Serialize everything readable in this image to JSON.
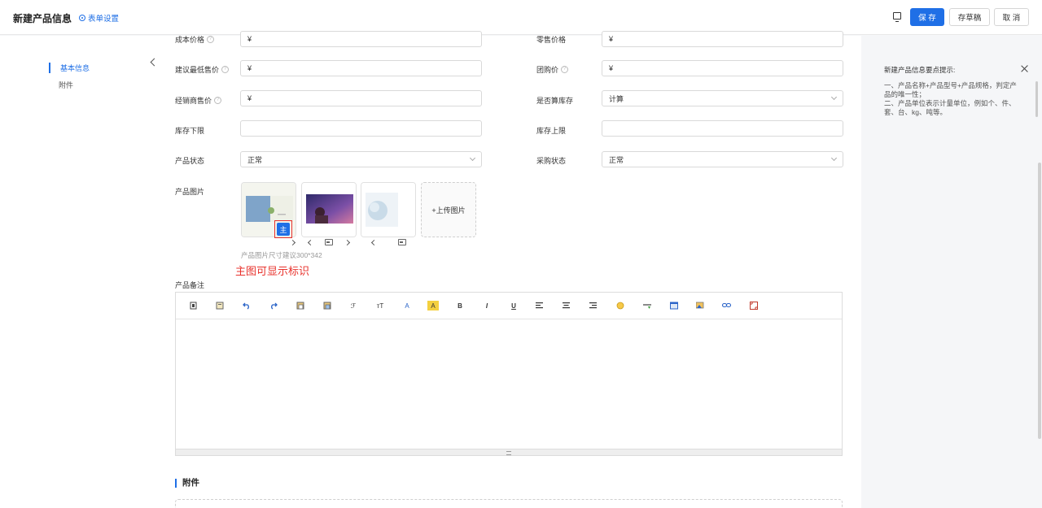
{
  "header": {
    "title": "新建产品信息",
    "form_settings": "表单设置",
    "save": "保 存",
    "draft": "存草稿",
    "cancel": "取 消"
  },
  "sidenav": {
    "items": [
      {
        "label": "基本信息",
        "active": true
      },
      {
        "label": "附件",
        "active": false
      }
    ]
  },
  "form": {
    "cost_price": {
      "label": "成本价格",
      "value": "¥"
    },
    "retail_price": {
      "label": "零售价格",
      "value": "¥"
    },
    "min_price": {
      "label": "建议最低售价",
      "value": "¥"
    },
    "group_price": {
      "label": "团购价",
      "value": "¥"
    },
    "dealer_price": {
      "label": "经销商售价",
      "value": "¥"
    },
    "count_stock": {
      "label": "是否算库存",
      "value": "计算"
    },
    "stock_min": {
      "label": "库存下限",
      "value": ""
    },
    "stock_max": {
      "label": "库存上限",
      "value": ""
    },
    "product_status": {
      "label": "产品状态",
      "value": "正常"
    },
    "purchase_status": {
      "label": "采购状态",
      "value": "正常"
    },
    "product_images": {
      "label": "产品图片",
      "main_badge": "主",
      "upload_label": "+上传图片",
      "size_hint": "产品图片尺寸建议300*342"
    },
    "annotation": "主图可显示标识",
    "product_remark": {
      "label": "产品备注"
    }
  },
  "editor_toolbar": [
    "source-icon",
    "template-icon",
    "undo-icon",
    "redo-icon",
    "paste-icon",
    "paste-text-icon",
    "font-family-icon",
    "font-size-icon",
    "font-color-icon",
    "highlight-icon",
    "bold-icon",
    "italic-icon",
    "underline-icon",
    "align-left-icon",
    "align-center-icon",
    "align-right-icon",
    "emoji-icon",
    "insert-line-icon",
    "table-icon",
    "image-icon",
    "link-icon",
    "fullscreen-icon"
  ],
  "editor_glyphs": {
    "font_family": "ℱ",
    "font_size": "тT",
    "font_color": "A",
    "highlight": "A",
    "bold": "B",
    "italic": "I",
    "underline": "U"
  },
  "attachments": {
    "title": "附件"
  },
  "tips": {
    "title": "新建产品信息要点提示:",
    "body": "一、产品名称+产品型号+产品规格，判定产品的唯一性；\n二、产品单位表示计量单位，例如个、件、套、台、kg、吨等。"
  },
  "colors": {
    "accent": "#1f6fe6",
    "annotation": "#e8322c"
  }
}
